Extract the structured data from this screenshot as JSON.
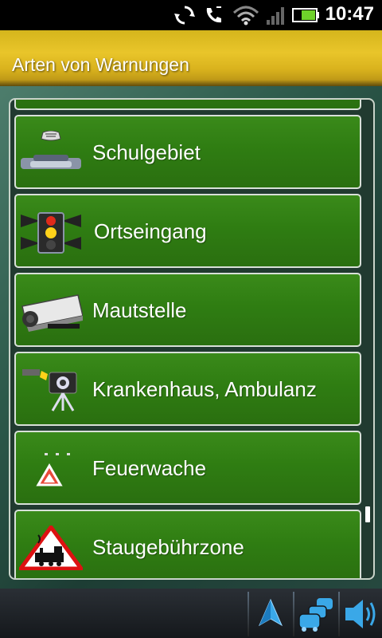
{
  "status_bar": {
    "time": "10:47",
    "icons": [
      "sync-icon",
      "phone-icon",
      "wifi-icon",
      "signal-icon",
      "battery-icon"
    ]
  },
  "header": {
    "title": "Arten von Warnungen"
  },
  "warnings": {
    "items": [
      {
        "label": "Schulgebiet",
        "icon": "school-zone-icon"
      },
      {
        "label": "Ortseingang",
        "icon": "traffic-light-icon"
      },
      {
        "label": "Mautstelle",
        "icon": "camera-icon"
      },
      {
        "label": "Krankenhaus, Ambulanz",
        "icon": "camera-tripod-icon"
      },
      {
        "label": "Feuerwache",
        "icon": "warning-triangle-icon"
      },
      {
        "label": "Staugebührzone",
        "icon": "railway-crossing-icon"
      }
    ]
  },
  "bottom_bar": {
    "buttons": [
      "navigation-arrow-icon",
      "traffic-icon",
      "volume-icon"
    ]
  },
  "colors": {
    "title_bar": "#e2bd24",
    "list_item": "#2f7d12",
    "background": "#1c2a26"
  }
}
